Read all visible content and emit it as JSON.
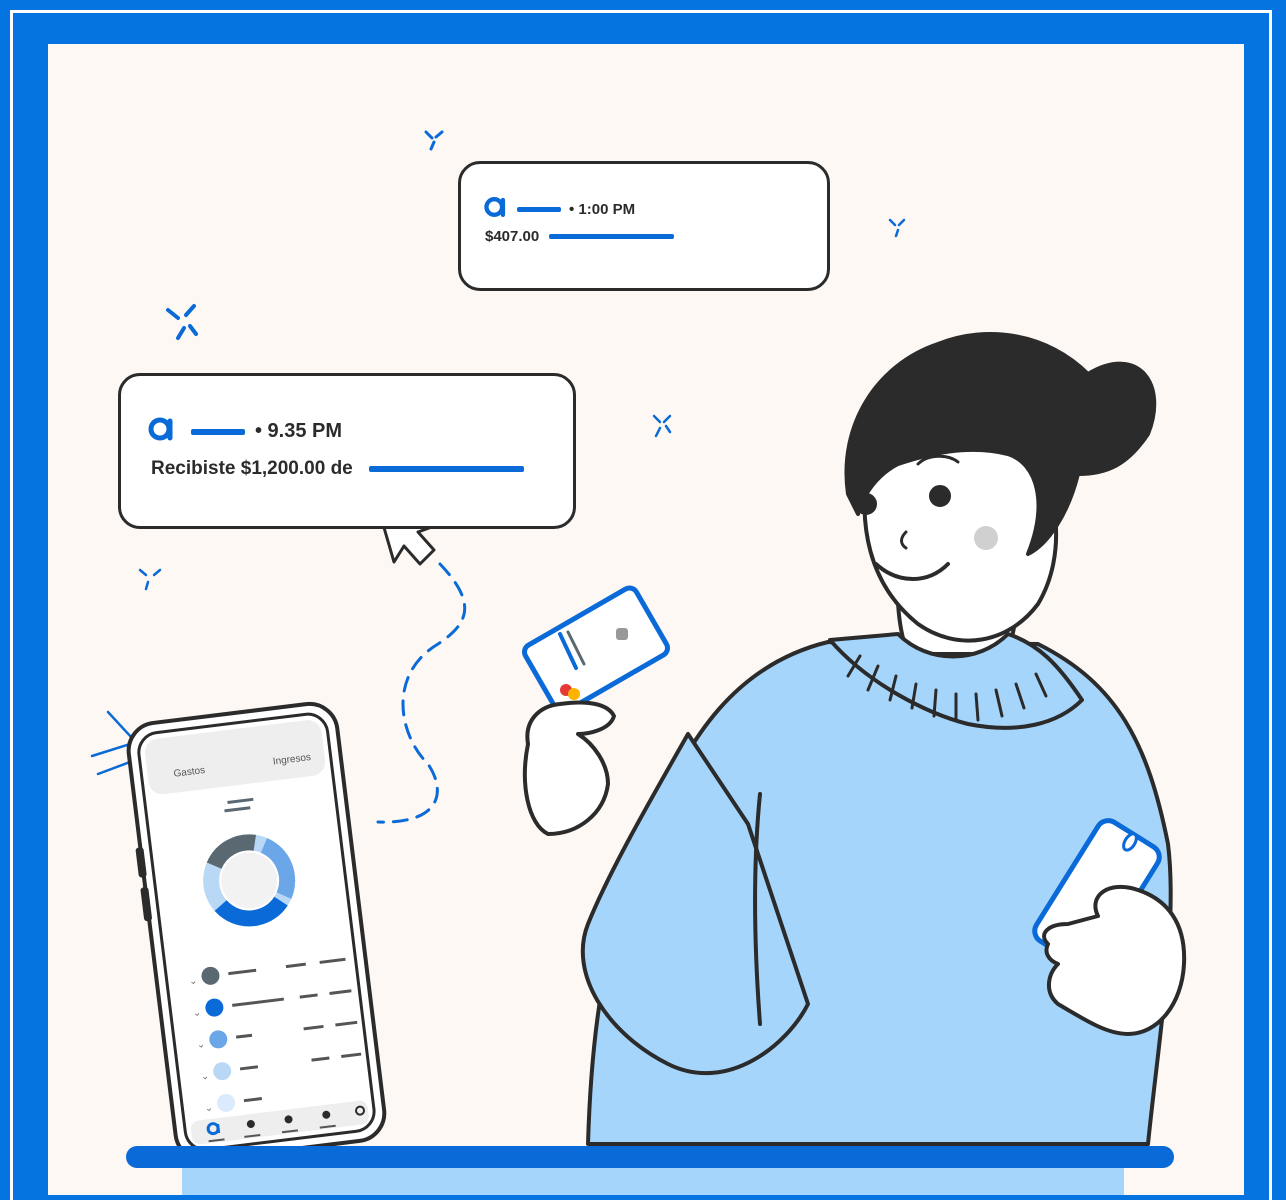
{
  "notifications": {
    "small": {
      "time": "• 1:00 PM",
      "amount": "$407.00"
    },
    "large": {
      "time": "• 9.35 PM",
      "message": "Recibiste  $1,200.00 de"
    }
  },
  "phone": {
    "tabs": [
      "Gastos",
      "Ingresos"
    ],
    "donut_colors": [
      "#5a6872",
      "#6aa6e8",
      "#0a6ad8",
      "#b9d8f6"
    ],
    "list_colors": [
      "#5a6872",
      "#0a6ad8",
      "#6aa6e8",
      "#b9d8f6",
      "#dbeafc"
    ]
  },
  "colors": {
    "brand_blue": "#0573e0",
    "sweater": "#a6d5fb",
    "background": "#fdf8f4",
    "ink": "#2b2b2b"
  },
  "icons": [
    "app-logo-icon",
    "cursor-arrow-icon",
    "sparkle-icon",
    "chevron-down-icon"
  ]
}
